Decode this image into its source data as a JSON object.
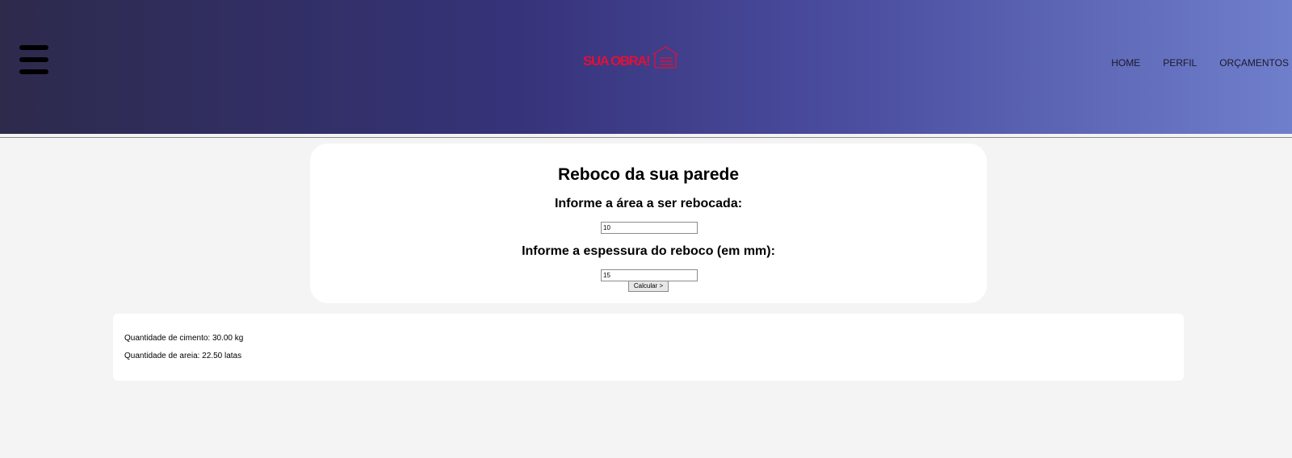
{
  "header": {
    "logo_text": "SUA OBRA!",
    "nav": [
      "HOME",
      "PERFIL",
      "ORÇAMENTOS"
    ],
    "menu_icon": "hamburger-menu-icon",
    "logo_icon": "house-icon",
    "logo_color": "#e0103a",
    "gradient": [
      "#2d2a4c",
      "#36337a",
      "#4a4c9e",
      "#6f7fcc"
    ]
  },
  "calculator": {
    "title": "Reboco da sua parede",
    "area_label": "Informe a área a ser rebocada:",
    "area_value": "10",
    "thickness_label": "Informe a espessura do reboco (em mm):",
    "thickness_value": "15",
    "submit_label": "Calcular >"
  },
  "results": {
    "cimento": "Quantidade de cimento: 30.00 kg",
    "areia": "Quantidade de areia: 22.50 latas"
  }
}
